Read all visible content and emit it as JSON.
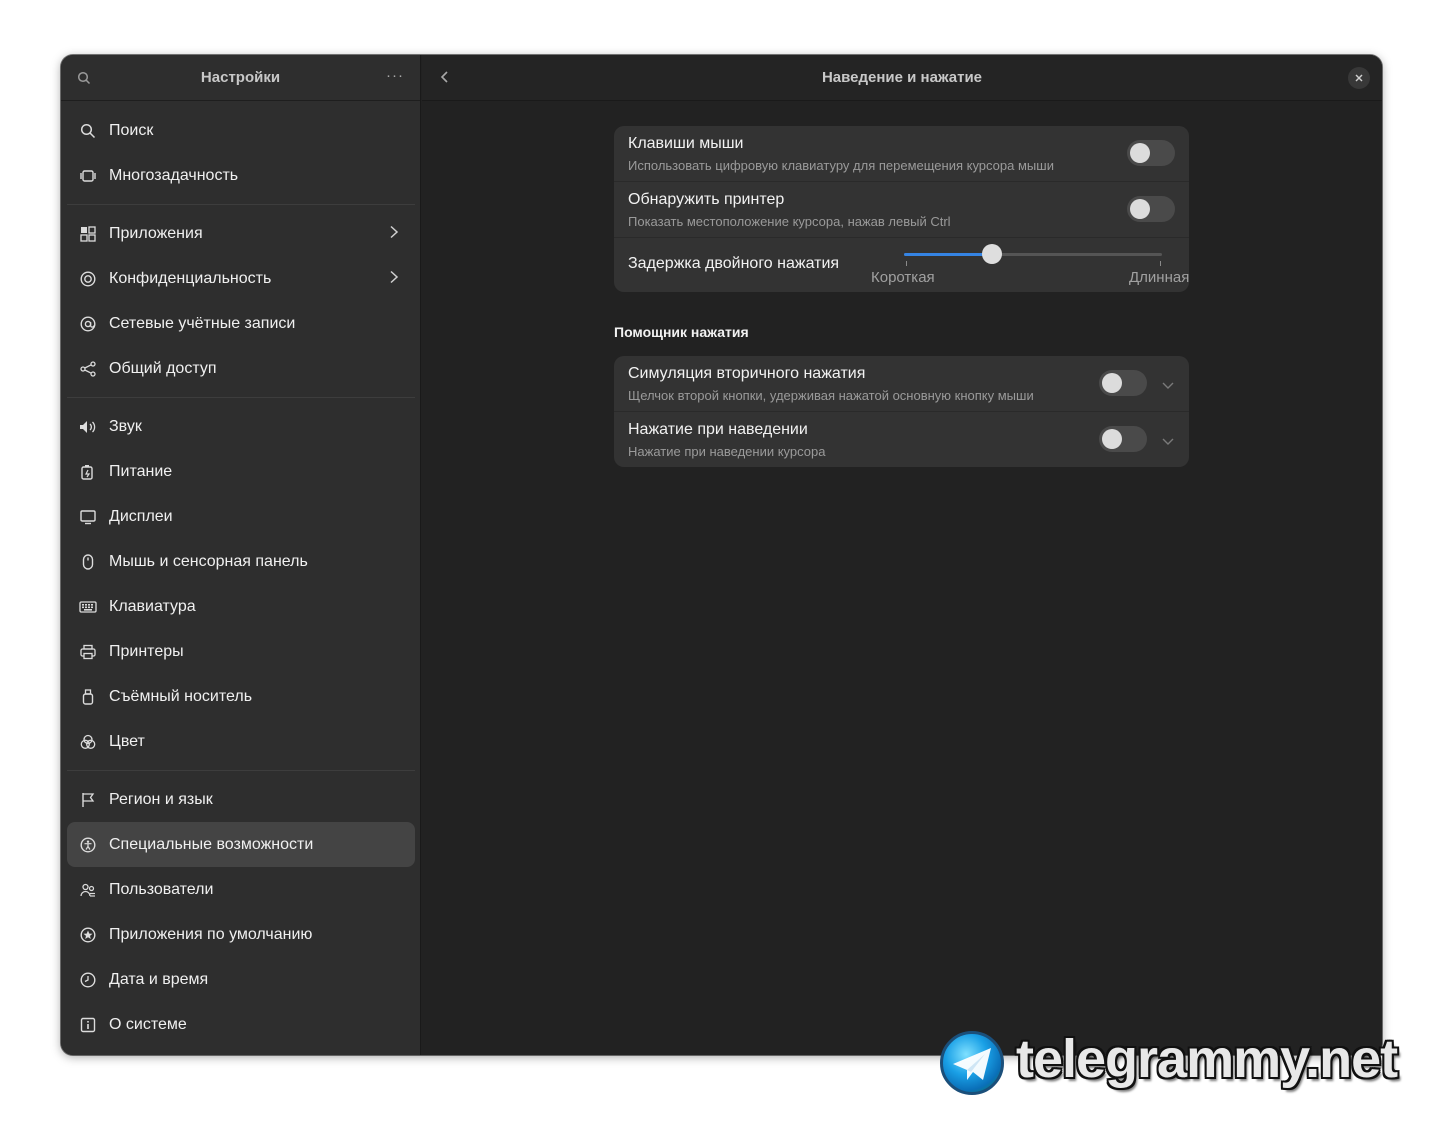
{
  "sidebar": {
    "title": "Настройки",
    "menu_label": "···",
    "groups": [
      [
        {
          "label": "Поиск",
          "icon": "search-icon"
        },
        {
          "label": "Многозадачность",
          "icon": "multitasking-icon"
        }
      ],
      [
        {
          "label": "Приложения",
          "icon": "apps-icon",
          "has_chevron": true
        },
        {
          "label": "Конфиденциальность",
          "icon": "privacy-icon",
          "has_chevron": true
        },
        {
          "label": "Сетевые учётные записи",
          "icon": "online-accounts-icon"
        },
        {
          "label": "Общий доступ",
          "icon": "sharing-icon"
        }
      ],
      [
        {
          "label": "Звук",
          "icon": "sound-icon"
        },
        {
          "label": "Питание",
          "icon": "power-icon"
        },
        {
          "label": "Дисплеи",
          "icon": "display-icon"
        },
        {
          "label": "Мышь и сенсорная панель",
          "icon": "mouse-icon"
        },
        {
          "label": "Клавиатура",
          "icon": "keyboard-icon"
        },
        {
          "label": "Принтеры",
          "icon": "printer-icon"
        },
        {
          "label": "Съёмный носитель",
          "icon": "removable-media-icon"
        },
        {
          "label": "Цвет",
          "icon": "color-icon"
        }
      ],
      [
        {
          "label": "Регион и язык",
          "icon": "region-flag-icon"
        },
        {
          "label": "Специальные возможности",
          "icon": "accessibility-icon",
          "active": true
        },
        {
          "label": "Пользователи",
          "icon": "users-icon"
        },
        {
          "label": "Приложения по умолчанию",
          "icon": "default-apps-icon"
        },
        {
          "label": "Дата и время",
          "icon": "clock-icon"
        },
        {
          "label": "О системе",
          "icon": "info-icon"
        }
      ]
    ]
  },
  "main": {
    "title": "Наведение и нажатие",
    "mouse_keys": {
      "title": "Клавиши мыши",
      "subtitle": "Использовать цифровую клавиатуру для перемещения курсора мыши",
      "enabled": false
    },
    "locate_pointer": {
      "title": "Обнаружить принтер",
      "subtitle": "Показать местоположение курсора, нажав левый Ctrl",
      "enabled": false
    },
    "double_click": {
      "title": "Задержка двойного нажатия",
      "min_label": "Короткая",
      "max_label": "Длинная",
      "value_fraction": 0.34
    },
    "click_assist": {
      "section_title": "Помощник нажатия",
      "secondary_click": {
        "title": "Симуляция вторичного нажатия",
        "subtitle": "Щелчок второй кнопки, удерживая нажатой основную кнопку мыши",
        "enabled": false
      },
      "hover_click": {
        "title": "Нажатие при наведении",
        "subtitle": "Нажатие при наведении курсора",
        "enabled": false
      }
    }
  },
  "watermark": {
    "text": "telegrammy.net"
  },
  "colors": {
    "accent": "#3584e4",
    "window_bg": "#222222",
    "sidebar_bg": "#2e2e2e",
    "card_bg": "#333333"
  }
}
